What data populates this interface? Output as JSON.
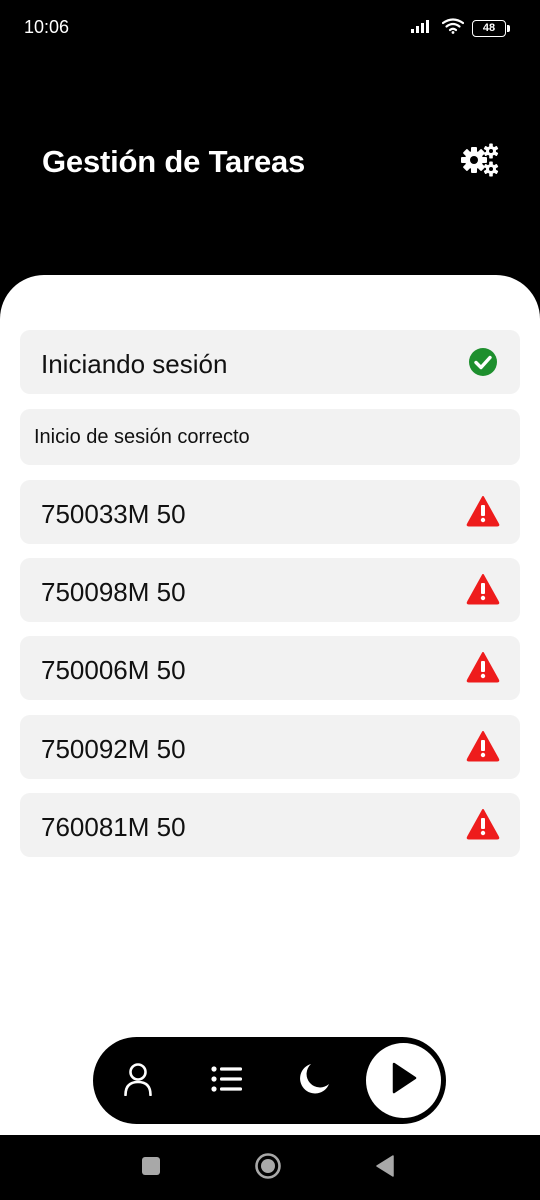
{
  "status_bar": {
    "time": "10:06",
    "battery_level": "48",
    "icons": [
      "signal-icon",
      "wifi-icon",
      "battery-icon"
    ]
  },
  "header": {
    "title": "Gestión de Tareas",
    "settings_icon": "gears-icon"
  },
  "tasks": [
    {
      "label": "Iniciando sesión",
      "status": "success",
      "icon": "check-circle-icon"
    },
    {
      "label": "Inicio de sesión correcto",
      "status": "info"
    },
    {
      "label": "750033M 50",
      "status": "warning",
      "icon": "warning-icon"
    },
    {
      "label": "750098M 50",
      "status": "warning",
      "icon": "warning-icon"
    },
    {
      "label": "750006M 50",
      "status": "warning",
      "icon": "warning-icon"
    },
    {
      "label": "750092M 50",
      "status": "warning",
      "icon": "warning-icon"
    },
    {
      "label": "760081M 50",
      "status": "warning",
      "icon": "warning-icon"
    }
  ],
  "bottom_nav": {
    "items": [
      "user-icon",
      "list-icon",
      "moon-icon",
      "play-icon"
    ]
  },
  "system_nav": {
    "items": [
      "recent-apps-icon",
      "home-icon",
      "back-icon"
    ]
  },
  "colors": {
    "header_bg": "#000000",
    "card_bg": "#f2f2f2",
    "success": "#1e8f2e",
    "warning": "#ee1c1c"
  }
}
